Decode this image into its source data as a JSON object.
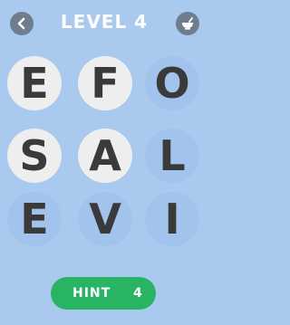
{
  "header": {
    "title": "LEVEL 4",
    "back_icon": "chevron-left-icon",
    "menu_icon": "bowl-icon"
  },
  "grid": {
    "rows": [
      [
        {
          "letter": "E",
          "selected": true
        },
        {
          "letter": "F",
          "selected": true
        },
        {
          "letter": "O",
          "selected": false
        }
      ],
      [
        {
          "letter": "S",
          "selected": true
        },
        {
          "letter": "A",
          "selected": true
        },
        {
          "letter": "L",
          "selected": false
        }
      ],
      [
        {
          "letter": "E",
          "selected": false
        },
        {
          "letter": "V",
          "selected": false
        },
        {
          "letter": "I",
          "selected": false
        }
      ]
    ]
  },
  "hint": {
    "label": "HINT",
    "count": "4"
  },
  "colors": {
    "background": "#a9c9ef",
    "tile_selected": "#eeeeee",
    "letter": "#3a3a3a",
    "hint_button": "#28b463"
  }
}
